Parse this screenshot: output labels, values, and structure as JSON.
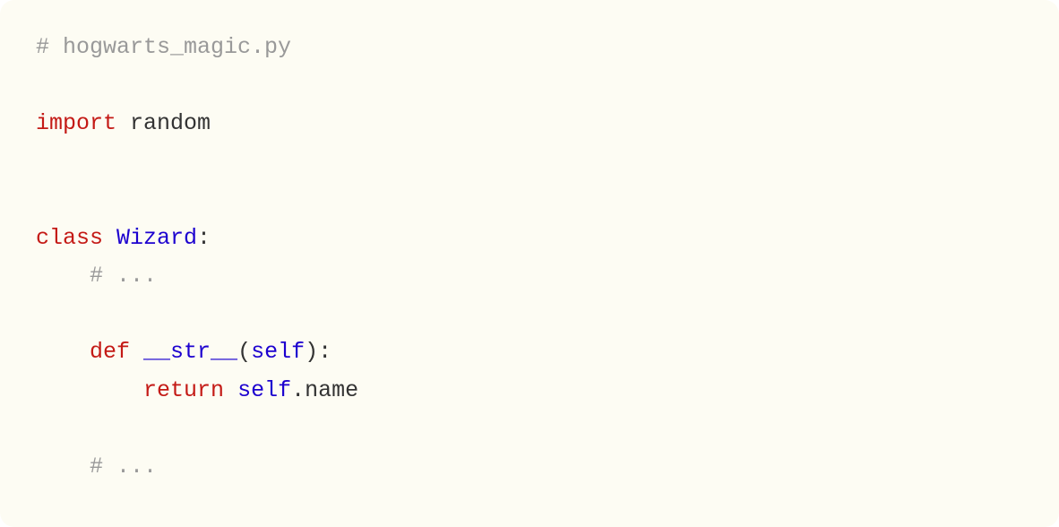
{
  "code": {
    "line1_comment": "# hogwarts_magic.py",
    "line2_blank": "",
    "line3_import": "import",
    "line3_module": " random",
    "line4_blank": "",
    "line5_blank": "",
    "line6_class": "class",
    "line6_name": " Wizard",
    "line6_colon": ":",
    "line7_indent": "    ",
    "line7_comment": "# ...",
    "line8_blank": "",
    "line9_indent": "    ",
    "line9_def": "def",
    "line9_name": " __str__",
    "line9_paren_open": "(",
    "line9_self": "self",
    "line9_paren_close": "):",
    "line10_indent": "        ",
    "line10_return": "return",
    "line10_space": " ",
    "line10_self": "self",
    "line10_dot_name": ".name",
    "line11_blank": "",
    "line12_indent": "    ",
    "line12_comment": "# ..."
  }
}
